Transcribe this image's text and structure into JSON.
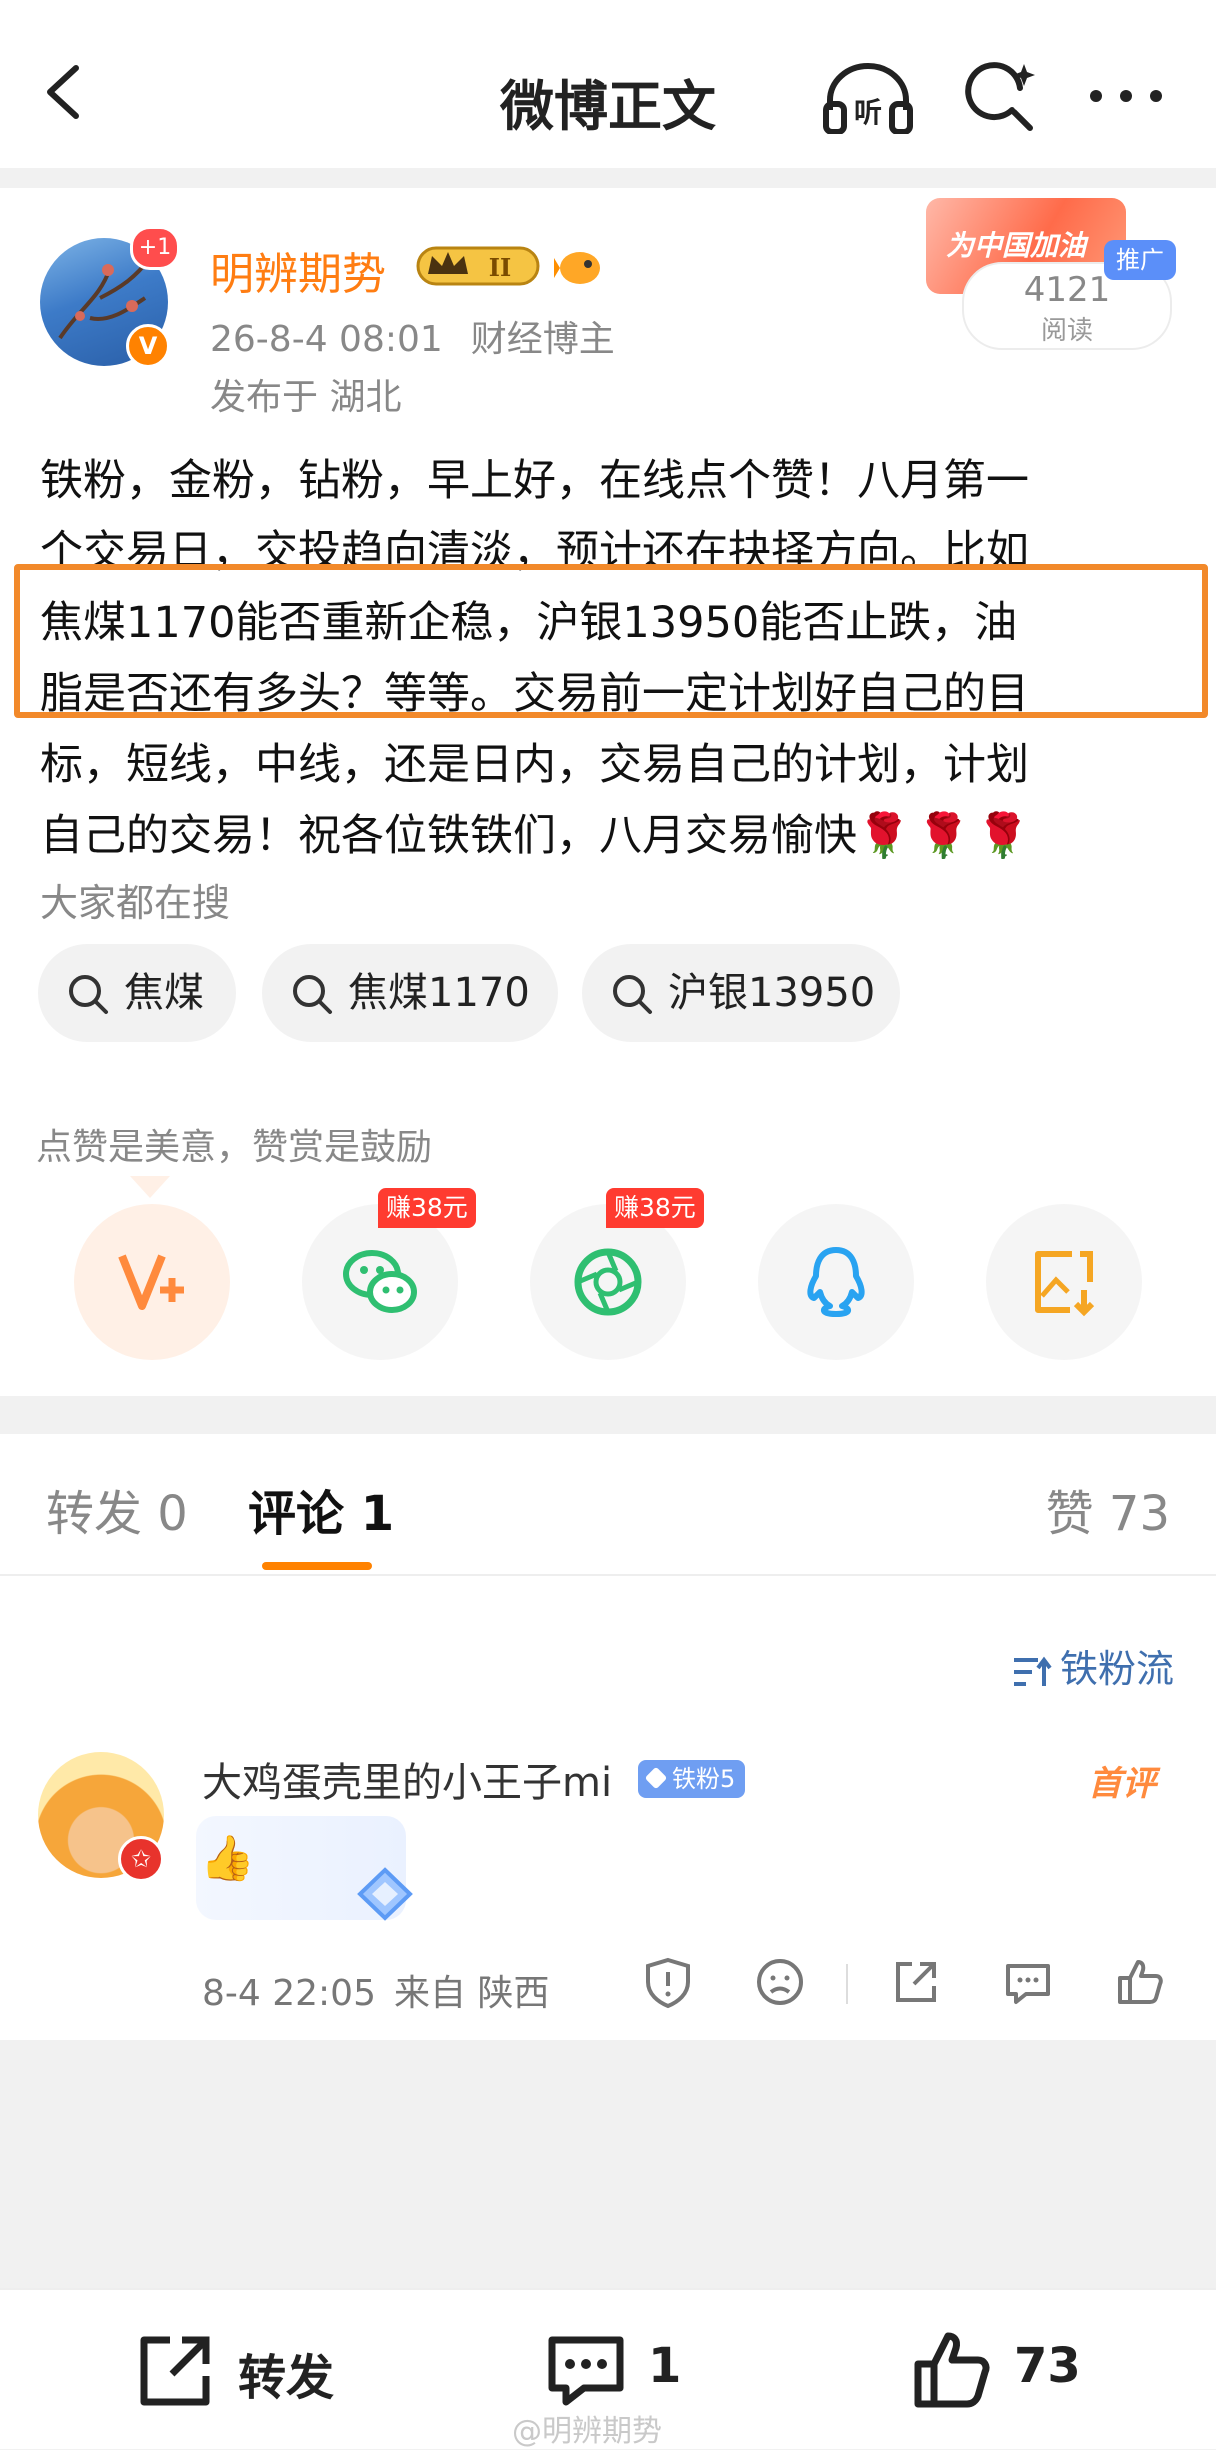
{
  "nav": {
    "title": "微博正文",
    "listen_icon": "headphone-listen-icon",
    "listen_label": "听"
  },
  "post": {
    "author": "明辨期势",
    "avatar_badge": "+1",
    "verified_badge": "V",
    "level_badge": "II",
    "date": "26-8-4 08:01",
    "author_role": "财经博主",
    "location": "发布于 湖北",
    "promo": {
      "banner": "为中国加油",
      "tag": "推广",
      "read_count": "4121",
      "read_label": "阅读"
    },
    "content_lines": [
      "铁粉，金粉，钻粉，早上好，在线点个赞！八月第一",
      "个交易日，交投趋向清淡，预计还在抉择方向。比如",
      "焦煤1170能否重新企稳，沪银13950能否止跌，油",
      "脂是否还有多头？等等。交易前一定计划好自己的目",
      "标，短线，中线，还是日内，交易自己的计划，计划",
      "自己的交易！祝各位铁铁们，八月交易愉快"
    ],
    "roses": "🌹🌹🌹",
    "highlight_color": "#f2892a",
    "search_header": "大家都在搜",
    "search_chips": [
      "焦煤",
      "焦煤1170",
      "沪银13950"
    ],
    "like_hint": "点赞是美意，赞赏是鼓励",
    "share_icons": [
      "reward-v-plus-icon",
      "wechat-icon",
      "moments-icon",
      "qq-icon",
      "save-image-icon"
    ],
    "earn_badges": [
      "赚38元",
      "赚38元"
    ]
  },
  "tabs": {
    "repost": "转发 0",
    "comments": "评论 1",
    "likes": "赞 73"
  },
  "comments": {
    "sort_label": "铁粉流",
    "items": [
      {
        "user": "大鸡蛋壳里的小王子mi",
        "fan_badge": "铁粉5",
        "first_tag": "首评",
        "emoji": "👍",
        "time": "8-4 22:05",
        "source": "来自 陕西"
      }
    ]
  },
  "bottom": {
    "repost": "转发",
    "comment_count": "1",
    "like_count": "73",
    "watermark": "@明辨期势"
  },
  "colors": {
    "accent": "#ff8200",
    "username": "#ff7d12",
    "link": "#3f6fae"
  }
}
